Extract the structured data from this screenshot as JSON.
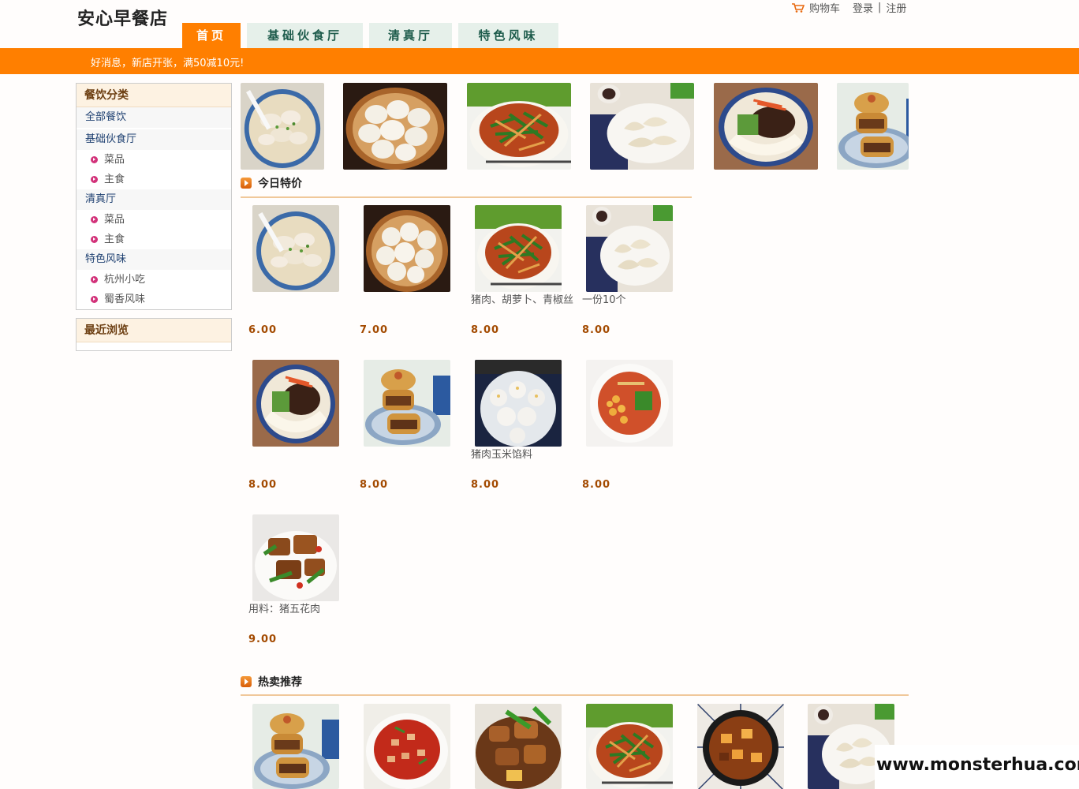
{
  "header": {
    "store_name": "安心早餐店",
    "cart_label": "购物车",
    "login_label": "登录",
    "separator": "|",
    "register_label": "注册"
  },
  "nav": {
    "tabs": [
      {
        "label": "首页",
        "active": true
      },
      {
        "label": "基础伙食厅",
        "active": false
      },
      {
        "label": "清真厅",
        "active": false
      },
      {
        "label": "特色风味",
        "active": false
      }
    ]
  },
  "banner": {
    "text": "好消息，新店开张，满50减10元!"
  },
  "sidebar": {
    "category_title": "餐饮分类",
    "all_label": "全部餐饮",
    "groups": [
      {
        "name": "基础伙食厅",
        "items": [
          "菜品",
          "主食"
        ]
      },
      {
        "name": "清真厅",
        "items": [
          "菜品",
          "主食"
        ]
      },
      {
        "name": "特色风味",
        "items": [
          "杭州小吃",
          "蜀香风味"
        ]
      }
    ],
    "recent_title": "最近浏览"
  },
  "strip_images": [
    "dumpling-soup",
    "steamed-buns",
    "shredded-pork",
    "boiled-dumplings",
    "zhajiang-noodles",
    "meat-pastry"
  ],
  "today_special": {
    "title": "今日特价",
    "products": [
      {
        "image": "dumpling-soup",
        "desc": "",
        "price": "6.00"
      },
      {
        "image": "steamed-buns",
        "desc": "",
        "price": "7.00"
      },
      {
        "image": "shredded-pork",
        "desc": "猪肉、胡萝卜、青椒丝",
        "price": "8.00"
      },
      {
        "image": "boiled-dumplings",
        "desc": "一份10个",
        "price": "8.00"
      },
      {
        "image": "zhajiang-noodles",
        "desc": "",
        "price": "8.00"
      },
      {
        "image": "meat-pastry",
        "desc": "",
        "price": "8.00"
      },
      {
        "image": "shumai",
        "desc": "猪肉玉米馅料",
        "price": "8.00"
      },
      {
        "image": "chickpea-noodles",
        "desc": "",
        "price": "8.00"
      },
      {
        "image": "braised-pork",
        "desc": "用料：猪五花肉",
        "price": "9.00"
      }
    ]
  },
  "hot_sale": {
    "title": "热卖推荐",
    "images": [
      "meat-pastry",
      "spicy-diced-chicken",
      "stir-fried-chicken",
      "shredded-pork",
      "potato-chicken",
      "boiled-dumplings"
    ]
  },
  "watermark": "www.monsterhua.com"
}
